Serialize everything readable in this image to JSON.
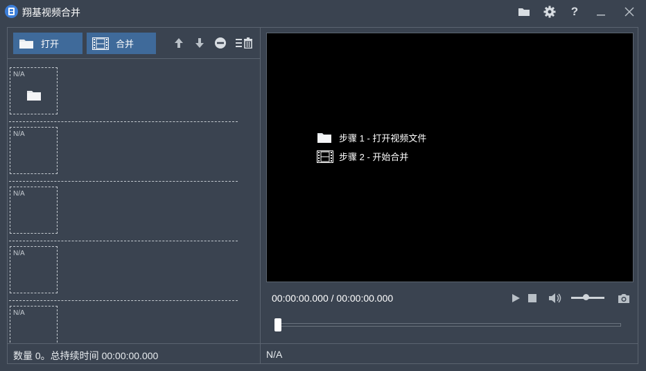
{
  "window": {
    "title": "翔基视频合并",
    "help_label": "?"
  },
  "toolbar": {
    "open_label": "打开",
    "merge_label": "合并"
  },
  "list": {
    "items": [
      {
        "thumb_label": "N/A"
      },
      {
        "thumb_label": "N/A"
      },
      {
        "thumb_label": "N/A"
      },
      {
        "thumb_label": "N/A"
      },
      {
        "thumb_label": "N/A"
      }
    ]
  },
  "preview": {
    "step1": "步骤 1 - 打开视频文件",
    "step2": "步骤 2 - 开始合并"
  },
  "player": {
    "time": "00:00:00.000 / 00:00:00.000",
    "volume_fraction": 0.45,
    "seek_fraction": 0.0
  },
  "status": {
    "summary": "数量 0。总持续时间 00:00:00.000",
    "info": "N/A"
  },
  "colors": {
    "background": "#3a4350",
    "button_accent": "#3f6a9a",
    "app_icon": "#3d7fd9"
  }
}
